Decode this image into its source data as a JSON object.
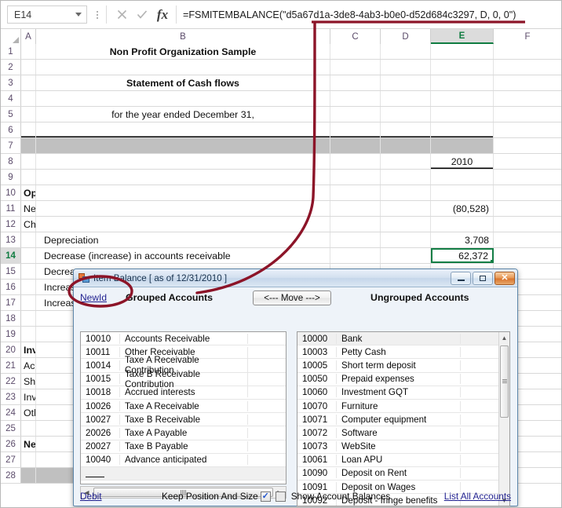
{
  "formula_bar": {
    "name_box_value": "E14",
    "cancel_icon": "x-icon",
    "confirm_icon": "check-icon",
    "function_icon": "fx-icon",
    "formula": "=FSMITEMBALANCE(\"d5a67d1a-3de8-4ab3-b0e0-d52d684c3297, D, 0, 0\")",
    "highlighted_guid": "d5a67d1a-3de8-4ab3-b0e0-d52d684c3297"
  },
  "sheet": {
    "columns": [
      "A",
      "B",
      "C",
      "D",
      "E",
      "F"
    ],
    "active_column": "E",
    "active_row": 14,
    "rows": [
      {
        "n": 1,
        "B": "Non Profit Organization Sample",
        "align": "ctr",
        "bold": true
      },
      {
        "n": 2,
        "B": ""
      },
      {
        "n": 3,
        "B": "Statement of Cash flows",
        "align": "ctr",
        "bold": true
      },
      {
        "n": 4,
        "B": ""
      },
      {
        "n": 5,
        "B": "for the year ended December 31,",
        "align": "ctr"
      },
      {
        "n": 6,
        "B": ""
      },
      {
        "n": 7,
        "B": "",
        "band": true
      },
      {
        "n": 8,
        "B": "",
        "E": "2010",
        "align_e": "ctr"
      },
      {
        "n": 9,
        "B": ""
      },
      {
        "n": 10,
        "A": "Operating activities",
        "bold": true
      },
      {
        "n": 11,
        "A": "Net income (loss)",
        "E": "(80,528)"
      },
      {
        "n": 12,
        "A": "Changes in current assets and current liabilities"
      },
      {
        "n": 13,
        "B": "Depreciation",
        "indent": 1,
        "E": "3,708"
      },
      {
        "n": 14,
        "B": "Decrease (increase) in accounts receivable",
        "indent": 1,
        "E": "62,372",
        "selected": true
      },
      {
        "n": 15,
        "B": "Decreas",
        "indent": 1
      },
      {
        "n": 16,
        "B": "Increas",
        "indent": 1
      },
      {
        "n": 17,
        "B": "Increas",
        "indent": 1
      },
      {
        "n": 18,
        "B": ""
      },
      {
        "n": 19,
        "B": ""
      },
      {
        "n": 20,
        "A": "Investing",
        "bold": true
      },
      {
        "n": 21,
        "A": "Acquisitio"
      },
      {
        "n": 22,
        "A": "Short term"
      },
      {
        "n": 23,
        "A": "Investme"
      },
      {
        "n": 24,
        "A": "Other ass"
      },
      {
        "n": 25,
        "B": ""
      },
      {
        "n": 26,
        "A": "Net incre",
        "bold": true
      },
      {
        "n": 27,
        "B": ""
      },
      {
        "n": 28,
        "B": "",
        "band": true
      }
    ]
  },
  "dialog": {
    "title": "Item Balance [ as of 12/31/2010 ]",
    "title_icon": "window-app-icon",
    "minimize_label": "",
    "restore_label": "",
    "close_label": "✕",
    "newid_link": "NewId",
    "grouped_header": "Grouped Accounts",
    "move_button": "<--- Move --->",
    "ungrouped_header": "Ungrouped Accounts",
    "grouped_accounts": [
      {
        "code": "10010",
        "name": "Accounts Receivable"
      },
      {
        "code": "10011",
        "name": "Other Receivable"
      },
      {
        "code": "10014",
        "name": "Taxe A Receivable Contribution"
      },
      {
        "code": "10015",
        "name": "Taxe B Receivable Contribution"
      },
      {
        "code": "10018",
        "name": "Accrued interests"
      },
      {
        "code": "10026",
        "name": "Taxe A Receivable"
      },
      {
        "code": "10027",
        "name": "Taxe B Receivable"
      },
      {
        "code": "20026",
        "name": "Taxe A Payable"
      },
      {
        "code": "20027",
        "name": "Taxe B Payable"
      },
      {
        "code": "10040",
        "name": "Advance anticipated"
      }
    ],
    "ungrouped_accounts": [
      {
        "code": "10000",
        "name": "Bank",
        "highlighted": true
      },
      {
        "code": "10003",
        "name": "Petty Cash"
      },
      {
        "code": "10005",
        "name": "Short term deposit"
      },
      {
        "code": "10050",
        "name": "Prepaid expenses"
      },
      {
        "code": "10060",
        "name": "Investment GQT"
      },
      {
        "code": "10070",
        "name": "Furniture"
      },
      {
        "code": "10071",
        "name": "Computer equipment"
      },
      {
        "code": "10072",
        "name": "Software"
      },
      {
        "code": "10073",
        "name": "WebSite"
      },
      {
        "code": "10061",
        "name": "Loan APU"
      },
      {
        "code": "10090",
        "name": "Deposit on Rent"
      },
      {
        "code": "10091",
        "name": "Deposit on Wages"
      },
      {
        "code": "10092",
        "name": "Deposit - fringe benefits"
      }
    ],
    "footer": {
      "debit_link": "Debit",
      "keep_position_label": "Keep Position And Size",
      "keep_position_checked": true,
      "show_balances_label": "Show Account Balances",
      "show_balances_checked": false,
      "list_all_link": "List All Accounts"
    }
  },
  "annotation": {
    "color": "#8c1428",
    "description": "underline-and-callout-to-newid"
  }
}
